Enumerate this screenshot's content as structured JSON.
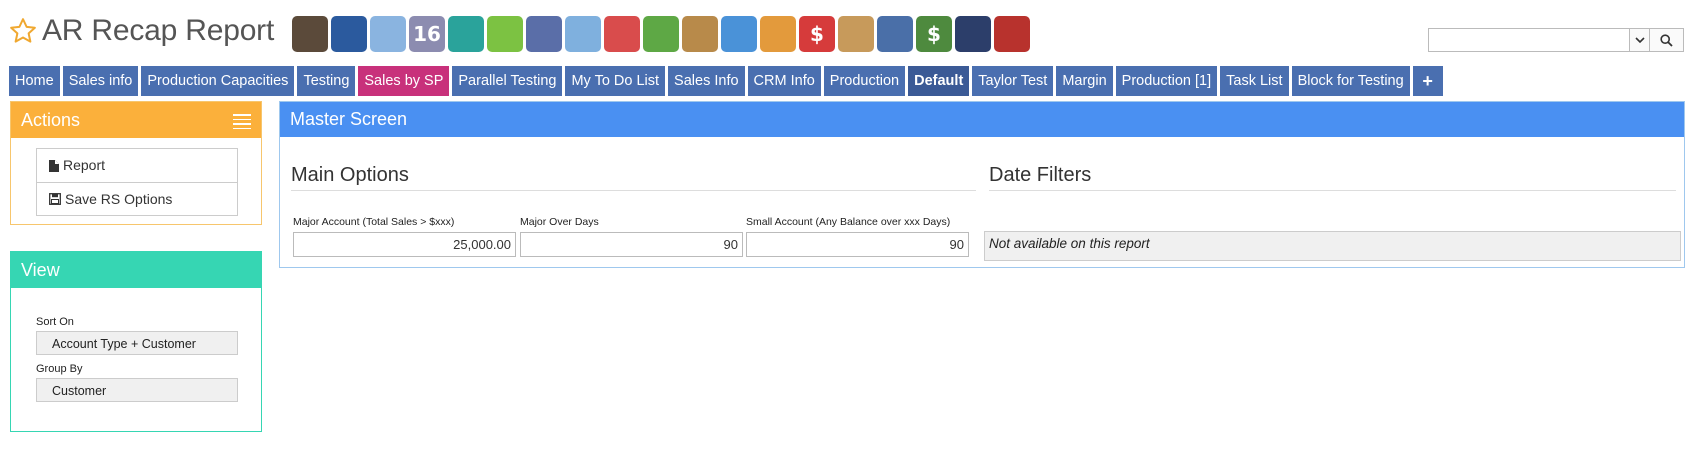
{
  "header": {
    "title": "AR Recap Report",
    "star_icon": "star-outline-icon",
    "toolbar_icons": [
      {
        "name": "bank-icon",
        "color": "#5b4a3a"
      },
      {
        "name": "user-icon",
        "color": "#2b5a9e"
      },
      {
        "name": "weather-icon",
        "color": "#8ab4e0"
      },
      {
        "name": "calendar-icon",
        "color": "#8c8cb0",
        "text": "16"
      },
      {
        "name": "clock-icon",
        "color": "#2aa39b"
      },
      {
        "name": "checkmark-icon",
        "color": "#7cc242"
      },
      {
        "name": "spreadsheet-icon",
        "color": "#5a6ea8"
      },
      {
        "name": "magnifier-icon",
        "color": "#7fb0de"
      },
      {
        "name": "bus-icon",
        "color": "#d94c4c"
      },
      {
        "name": "basket-icon",
        "color": "#5ea845"
      },
      {
        "name": "inbox-download-icon",
        "color": "#b88a4a"
      },
      {
        "name": "box-upload-icon",
        "color": "#4a92d8"
      },
      {
        "name": "handshake-icon",
        "color": "#e39a3c"
      },
      {
        "name": "dollar-chat-icon",
        "color": "#d63b3b",
        "text": "$"
      },
      {
        "name": "clipboard-icon",
        "color": "#c79a5b"
      },
      {
        "name": "pencil-note-icon",
        "color": "#4a6fa8"
      },
      {
        "name": "money-stack-icon",
        "color": "#4e8a3e",
        "text": "$"
      },
      {
        "name": "safe-icon",
        "color": "#2c3e6a"
      },
      {
        "name": "factory-icon",
        "color": "#b8322d"
      }
    ]
  },
  "search": {
    "value": "",
    "placeholder": ""
  },
  "tabs": [
    {
      "label": "Home",
      "type": "normal"
    },
    {
      "label": "Sales info",
      "type": "normal"
    },
    {
      "label": "Production Capacities",
      "type": "normal"
    },
    {
      "label": "Testing",
      "type": "normal"
    },
    {
      "label": "Sales by SP",
      "type": "sp"
    },
    {
      "label": "Parallel Testing",
      "type": "normal"
    },
    {
      "label": "My To Do List",
      "type": "normal"
    },
    {
      "label": "Sales Info",
      "type": "normal"
    },
    {
      "label": "CRM Info",
      "type": "normal"
    },
    {
      "label": "Production",
      "type": "normal"
    },
    {
      "label": "Default",
      "type": "default"
    },
    {
      "label": "Taylor Test",
      "type": "normal"
    },
    {
      "label": "Margin",
      "type": "normal"
    },
    {
      "label": "Production [1]",
      "type": "normal"
    },
    {
      "label": "Task List",
      "type": "normal"
    },
    {
      "label": "Block for Testing",
      "type": "normal"
    },
    {
      "label": "+",
      "type": "plus"
    }
  ],
  "actions": {
    "title": "Actions",
    "items": [
      {
        "label": "Report",
        "icon": "document-icon"
      },
      {
        "label": "Save RS Options",
        "icon": "floppy-disk-icon"
      }
    ]
  },
  "view": {
    "title": "View",
    "sort_label": "Sort On",
    "sort_value": "Account Type + Customer",
    "group_label": "Group By",
    "group_value": "Customer"
  },
  "master": {
    "title": "Master Screen",
    "main_options_title": "Main Options",
    "date_filters_title": "Date Filters",
    "fields": [
      {
        "label": "Major Account (Total Sales > $xxx)",
        "value": "25,000.00"
      },
      {
        "label": "Major Over Days",
        "value": "90"
      },
      {
        "label": "Small Account (Any Balance over xxx Days)",
        "value": "90"
      }
    ],
    "date_filters_note": "Not available on this report"
  },
  "colors": {
    "tab": "#4a6fb0",
    "tab_sp": "#c8317b",
    "actions_header": "#fbb03b",
    "view_header": "#36d6b3",
    "master_header": "#4a90f2"
  }
}
